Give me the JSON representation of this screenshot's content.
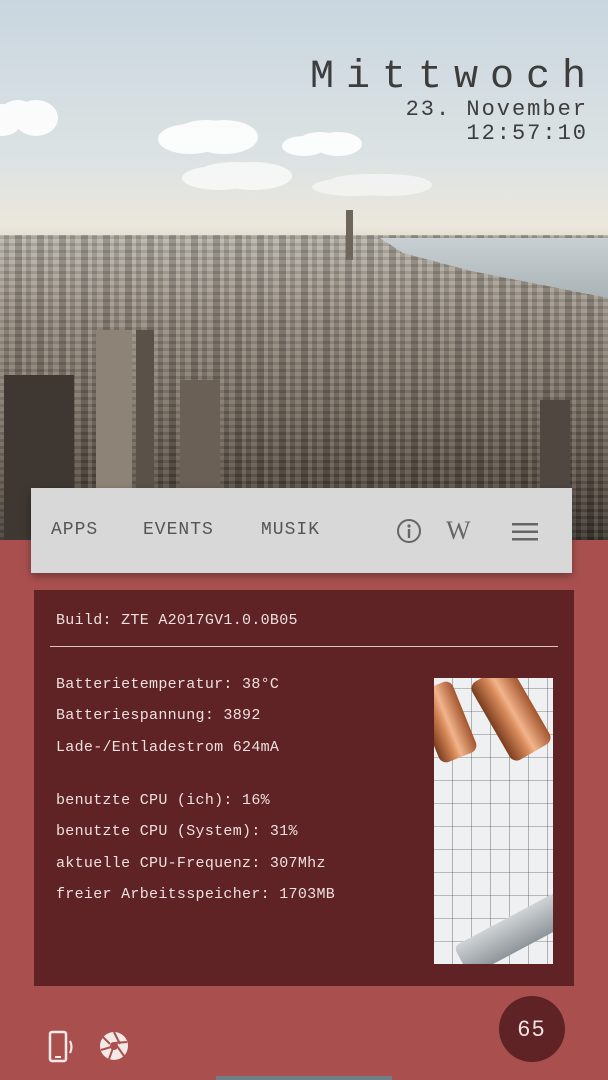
{
  "clock": {
    "day": "Mittwoch",
    "date": "23. November",
    "time": "12:57:10"
  },
  "nav": {
    "items": [
      "APPS",
      "EVENTS",
      "MUSIK"
    ],
    "icons": [
      "info-icon",
      "wikipedia-icon",
      "menu-icon"
    ]
  },
  "info": {
    "build": "Build: ZTE A2017GV1.0.0B05",
    "battery": [
      "Batterietemperatur: 38°C",
      "Batteriespannung: 3892",
      "Lade-/Entladestrom 624mA"
    ],
    "system": [
      "benutzte CPU (ich): 16%",
      "benutzte CPU (System): 31%",
      "aktuelle CPU-Frequenz: 307Mhz",
      "freier Arbeitsspeicher: 1703MB"
    ]
  },
  "bottom": {
    "icons": [
      "phone-vibrate-icon",
      "aperture-icon"
    ],
    "badge": "65"
  },
  "colors": {
    "accent": "#5f2225",
    "background": "#a9504f",
    "navbar": "#d8d8d8"
  }
}
